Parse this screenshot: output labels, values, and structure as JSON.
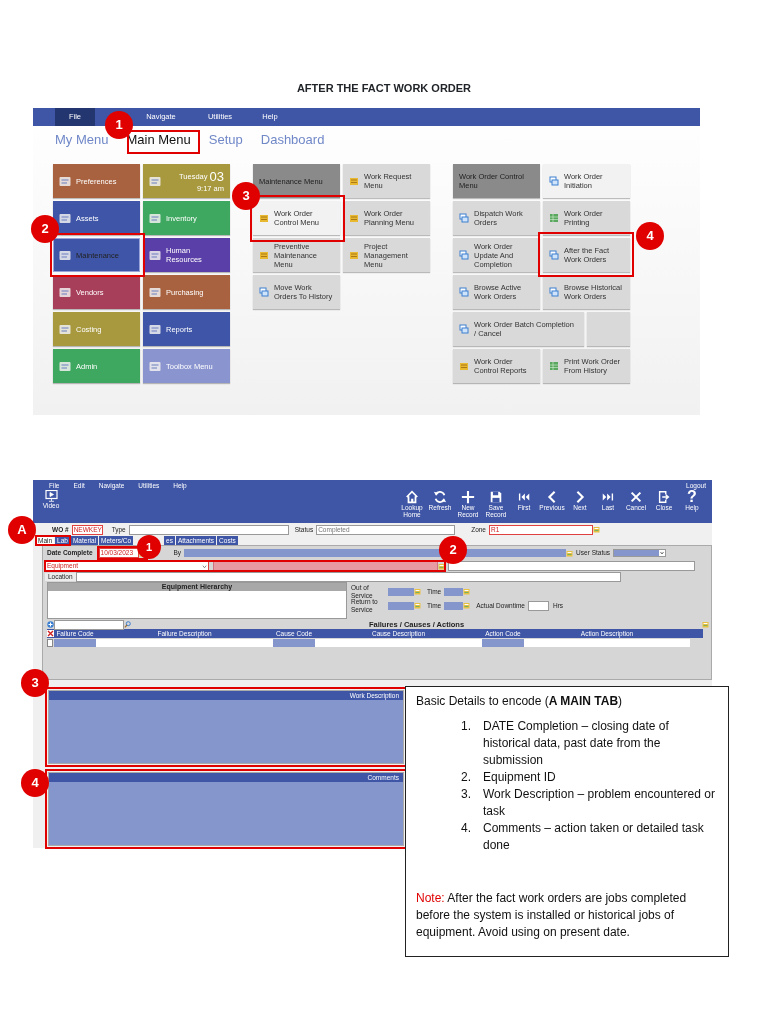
{
  "document_title": "AFTER THE FACT WORK ORDER",
  "main_menu_screen": {
    "menu_bar": [
      {
        "label": "File",
        "selected": true
      },
      {
        "label": "Navigate",
        "selected": false
      },
      {
        "label": "Utilities",
        "selected": false
      },
      {
        "label": "Help",
        "selected": false
      }
    ],
    "tabs": [
      {
        "label": "My Menu",
        "selected": false
      },
      {
        "label": "Main Menu",
        "selected": true
      },
      {
        "label": "Setup",
        "selected": false
      },
      {
        "label": "Dashboard",
        "selected": false
      }
    ],
    "module_tiles": [
      {
        "kind": "module",
        "label": "Preferences",
        "color": "#a8623f",
        "selected": false
      },
      {
        "kind": "clock",
        "day": "Tuesday",
        "date": "03",
        "time": "9:17 am",
        "color": "#a8993f",
        "selected": false
      },
      {
        "kind": "module",
        "label": "Assets",
        "color": "#3f56a8",
        "selected": false
      },
      {
        "kind": "module",
        "label": "Inventory",
        "color": "#3fa860",
        "selected": false
      },
      {
        "kind": "module",
        "label": "Maintenance",
        "color": "#3f56a8",
        "selected": true
      },
      {
        "kind": "module",
        "label": "Human Resources",
        "color": "#5a3fa8",
        "selected": false
      },
      {
        "kind": "module",
        "label": "Vendors",
        "color": "#a83f5a",
        "selected": false
      },
      {
        "kind": "module",
        "label": "Purchasing",
        "color": "#a8623f",
        "selected": false
      },
      {
        "kind": "module",
        "label": "Costing",
        "color": "#a8993f",
        "selected": false
      },
      {
        "kind": "module",
        "label": "Reports",
        "color": "#3f56a8",
        "selected": false
      },
      {
        "kind": "module",
        "label": "Admin",
        "color": "#3fa860",
        "selected": false
      },
      {
        "kind": "module",
        "label": "Toolbox Menu",
        "color": "#8a94cf",
        "selected": false
      }
    ],
    "maintenance_tiles": [
      {
        "kind": "header",
        "label": "Maintenance Menu",
        "selected": false
      },
      {
        "kind": "folder",
        "label": "Work Request Menu",
        "selected": false
      },
      {
        "kind": "folder",
        "label": "Work Order Control Menu",
        "selected": true
      },
      {
        "kind": "folder",
        "label": "Work Order Planning Menu",
        "selected": false
      },
      {
        "kind": "folder",
        "label": "Preventive Maintenance Menu",
        "selected": false
      },
      {
        "kind": "folder",
        "label": "Project Management Menu",
        "selected": false
      },
      {
        "kind": "windows",
        "label": "Move Work Orders To History",
        "selected": false
      }
    ],
    "work_order_tiles": [
      {
        "kind": "header",
        "label": "Work Order Control Menu",
        "selected": false
      },
      {
        "kind": "windows",
        "label": "Work Order Initiation",
        "selected": true
      },
      {
        "kind": "windows",
        "label": "Dispatch Work Orders",
        "selected": false
      },
      {
        "kind": "sheet",
        "label": "Work Order Printing",
        "selected": false
      },
      {
        "kind": "windows",
        "label": "Work Order Update And Completion",
        "selected": false
      },
      {
        "kind": "windows",
        "label": "After the Fact Work Orders",
        "selected": false
      },
      {
        "kind": "windows",
        "label": "Browse Active Work Orders",
        "selected": false
      },
      {
        "kind": "windows",
        "label": "Browse Historical Work Orders",
        "selected": false
      },
      {
        "kind": "wide",
        "label": "Work Order Batch Completion / Cancel",
        "selected": false
      },
      {
        "kind": "blank",
        "selected": false
      },
      {
        "kind": "folder",
        "label": "Work Order Control Reports",
        "selected": false
      },
      {
        "kind": "sheet",
        "label": "Print Work Order From History",
        "selected": false
      }
    ],
    "markers": [
      {
        "label": "1"
      },
      {
        "label": "2"
      },
      {
        "label": "3"
      },
      {
        "label": "4"
      }
    ]
  },
  "work_order_screen": {
    "menu_bar": [
      "File",
      "Edit",
      "Navigate",
      "Utilities",
      "Help"
    ],
    "logout": "Logout",
    "video_button": "Video",
    "toolbar": [
      {
        "kind": "home",
        "label": "Lookup Home"
      },
      {
        "kind": "refresh",
        "label": "Refresh"
      },
      {
        "kind": "plus",
        "label": "New Record"
      },
      {
        "kind": "save",
        "label": "Save Record"
      },
      {
        "kind": "first",
        "label": "First"
      },
      {
        "kind": "previous",
        "label": "Previous"
      },
      {
        "kind": "next",
        "label": "Next"
      },
      {
        "kind": "last",
        "label": "Last"
      },
      {
        "kind": "cancel",
        "label": "Cancel"
      },
      {
        "kind": "close",
        "label": "Close"
      },
      {
        "kind": "help",
        "glyph": "?",
        "label": "Help"
      }
    ],
    "header_fields": [
      {
        "label": "WO #",
        "value": "NEWKEY",
        "required": true
      },
      {
        "label": "Type",
        "required": false
      },
      {
        "label": "Status",
        "value": "Completed",
        "required": false
      },
      {
        "label": "Zone",
        "value": "R1",
        "required": true
      }
    ],
    "tabs": [
      {
        "label": "Main",
        "selected": true
      },
      {
        "label": "Lab",
        "selected": false
      },
      {
        "label": "Material",
        "selected": false
      },
      {
        "label": "Meters/Co",
        "selected": false
      },
      {
        "label": "es",
        "selected": false
      },
      {
        "label": "Attachments",
        "selected": false
      },
      {
        "label": "Costs",
        "selected": false
      }
    ],
    "date_completed": {
      "label": "Date Complete",
      "value": "10/03/2023"
    },
    "by_label": "By",
    "user_status_label": "User Status",
    "equipment": {
      "placeholder": "Equipment"
    },
    "location_label": "Location",
    "hierarchy_title": "Equipment Hierarchy",
    "out_of_service_label": "Out of Service",
    "return_to_service_label": "Return to Service",
    "time_labels": [
      "Time",
      "Time"
    ],
    "downtime_label": "Actual Downtime",
    "hours_unit": "Hrs",
    "failures": {
      "title": "Failures / Causes / Actions",
      "columns": [
        "Failure Code",
        "Failure Description",
        "Cause Code",
        "Cause Description",
        "Action Code",
        "Action Description"
      ],
      "rows": [
        {
          "checked": false
        }
      ]
    },
    "work_description_title": "Work Description",
    "comments_title": "Comments",
    "markers": [
      {
        "label": "A"
      },
      {
        "label": "1"
      },
      {
        "label": "2"
      },
      {
        "label": "3"
      },
      {
        "label": "4"
      }
    ]
  },
  "callout": {
    "heading": "Basic Details to encode (**A MAIN TAB**)",
    "steps": [
      {
        "number": "1.",
        "text": "DATE Completion – closing date of historical data, past date from the submission"
      },
      {
        "number": "2.",
        "text": "Equipment ID"
      },
      {
        "number": "3.",
        "text": "Work Description – problem encountered or task"
      },
      {
        "number": "4.",
        "text": "Comments – action taken or detailed task done"
      }
    ],
    "note_label": "Note:",
    "note_text": "After the fact work orders are jobs completed before the system is installed or historical jobs of equipment. Avoid using on present date."
  }
}
